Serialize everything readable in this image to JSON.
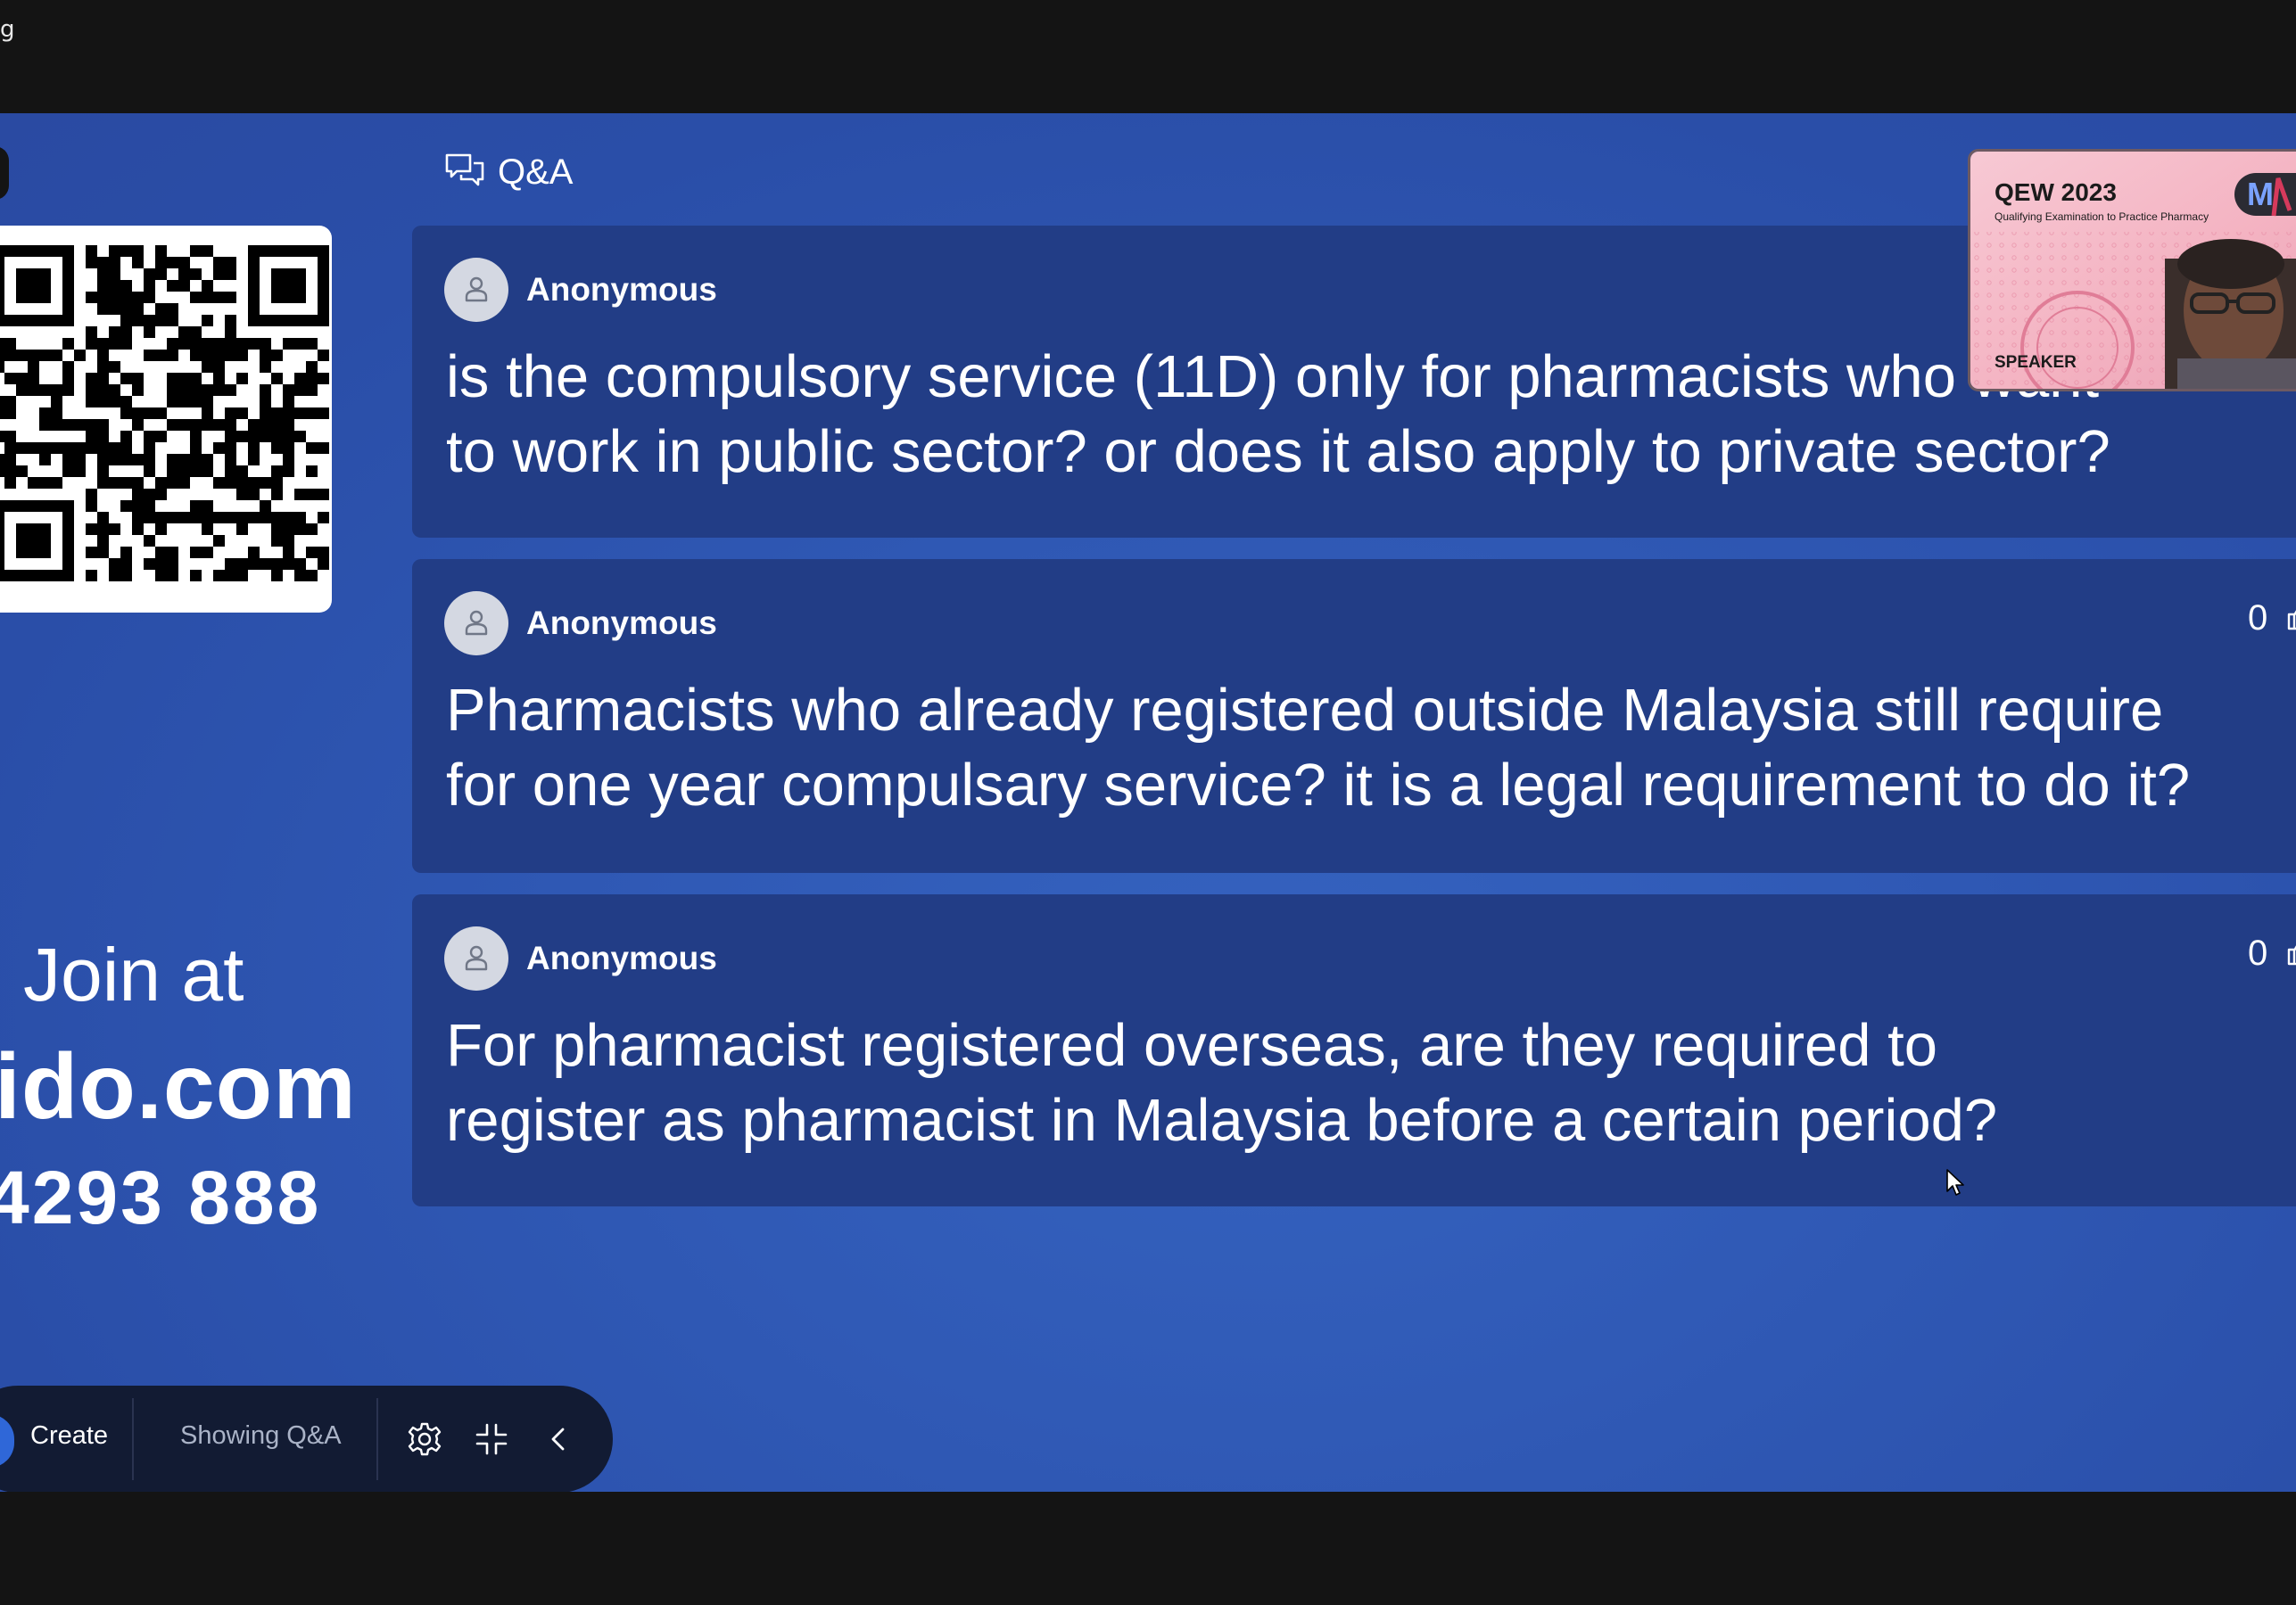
{
  "window": {
    "title_fragment": "g"
  },
  "qa_panel": {
    "title": "Q&A",
    "questions": [
      {
        "author": "Anonymous",
        "votes": "",
        "text_line1": "is the compulsory service (11D) only for pharmacists who want",
        "text_line2": "to work in public sector? or does it also apply to private sector?"
      },
      {
        "author": "Anonymous",
        "votes": "0",
        "text_line1": "Pharmacists who already registered outside Malaysia still require",
        "text_line2": "for one year compulsary service? it is a legal requirement to do it?"
      },
      {
        "author": "Anonymous",
        "votes": "0",
        "text_line1": "For pharmacist registered overseas, are they required to",
        "text_line2": "register as pharmacist in Malaysia before a certain period?"
      }
    ]
  },
  "join": {
    "line": "Join at",
    "domain": "ido.com",
    "code": "4293 888"
  },
  "speaker_video": {
    "title": "QEW 2023",
    "subtitle": "Qualifying Examination to Practice Pharmacy",
    "badge": "M",
    "label": "SPEAKER"
  },
  "toolbar": {
    "create_label": "Create",
    "status_label": "Showing Q&A"
  },
  "icons": {
    "header": "chat-bubbles-icon",
    "avatar": "user-avatar-icon",
    "votes": "thumbs-up-icon",
    "settings": "gear-icon",
    "collapse": "collapse-icon",
    "back": "chevron-left-icon"
  },
  "colors": {
    "stage_bg": "#2f58b4",
    "card_bg": "#223d86",
    "toolbar_bg": "#121b33",
    "accent_blue": "#2f67d8"
  }
}
